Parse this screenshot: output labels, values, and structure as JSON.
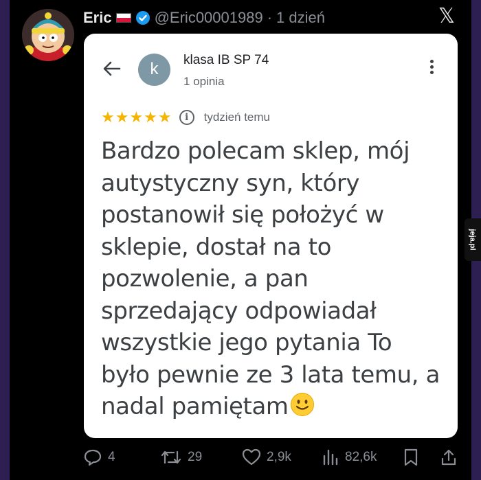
{
  "tweet": {
    "author_name": "Eric",
    "handle": "@Eric00001989",
    "separator": "·",
    "time": "1 dzień",
    "flag": "poland-flag",
    "verified": true,
    "platform_logo": "x-logo"
  },
  "review_card": {
    "reviewer_initial": "k",
    "reviewer_name": "klasa IB SP 74",
    "reviewer_reviews": "1 opinia",
    "stars": "★★★★★",
    "rating": 5,
    "date": "tydzień temu",
    "text_lines": [
      "Bardzo polecam sklep, mój",
      "autystyczny syn, który",
      "postanowił się położyć w",
      "sklepie, dostał na to",
      "pozwolenie, a pan",
      "sprzedający odpowiadał",
      "wszystkie jego pytania To",
      "było pewnie ze 3 lata temu, a",
      "nadal pamiętam"
    ],
    "emoji": "slightly-smiling-face"
  },
  "actions": {
    "replies": "4",
    "reposts": "29",
    "likes": "2,9k",
    "views": "82,6k"
  },
  "watermark": "jeja.pl",
  "colors": {
    "background": "#000000",
    "frame": "#2e1f52",
    "muted": "#8b8f95",
    "verified": "#1d9bf0",
    "stars": "#f4b400",
    "card": "#ffffff"
  }
}
